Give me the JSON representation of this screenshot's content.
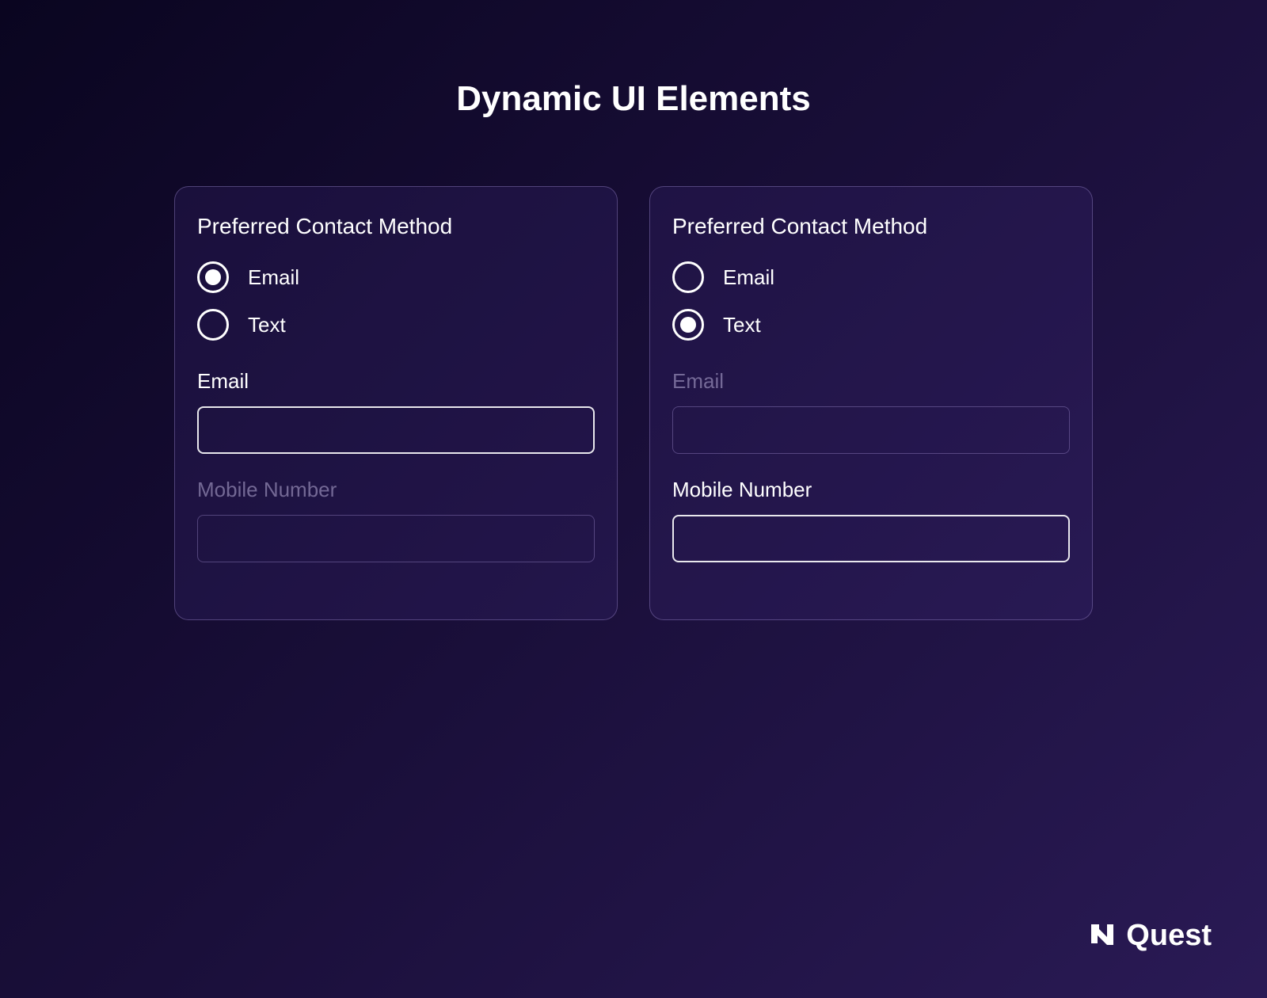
{
  "page": {
    "title": "Dynamic UI Elements"
  },
  "cards": [
    {
      "title": "Preferred Contact Method",
      "radios": [
        {
          "label": "Email",
          "selected": true
        },
        {
          "label": "Text",
          "selected": false
        }
      ],
      "fields": [
        {
          "label": "Email",
          "value": "",
          "active": true
        },
        {
          "label": "Mobile Number",
          "value": "",
          "active": false
        }
      ]
    },
    {
      "title": "Preferred Contact Method",
      "radios": [
        {
          "label": "Email",
          "selected": false
        },
        {
          "label": "Text",
          "selected": true
        }
      ],
      "fields": [
        {
          "label": "Email",
          "value": "",
          "active": false
        },
        {
          "label": "Mobile Number",
          "value": "",
          "active": true
        }
      ]
    }
  ],
  "brand": {
    "name": "Quest"
  }
}
